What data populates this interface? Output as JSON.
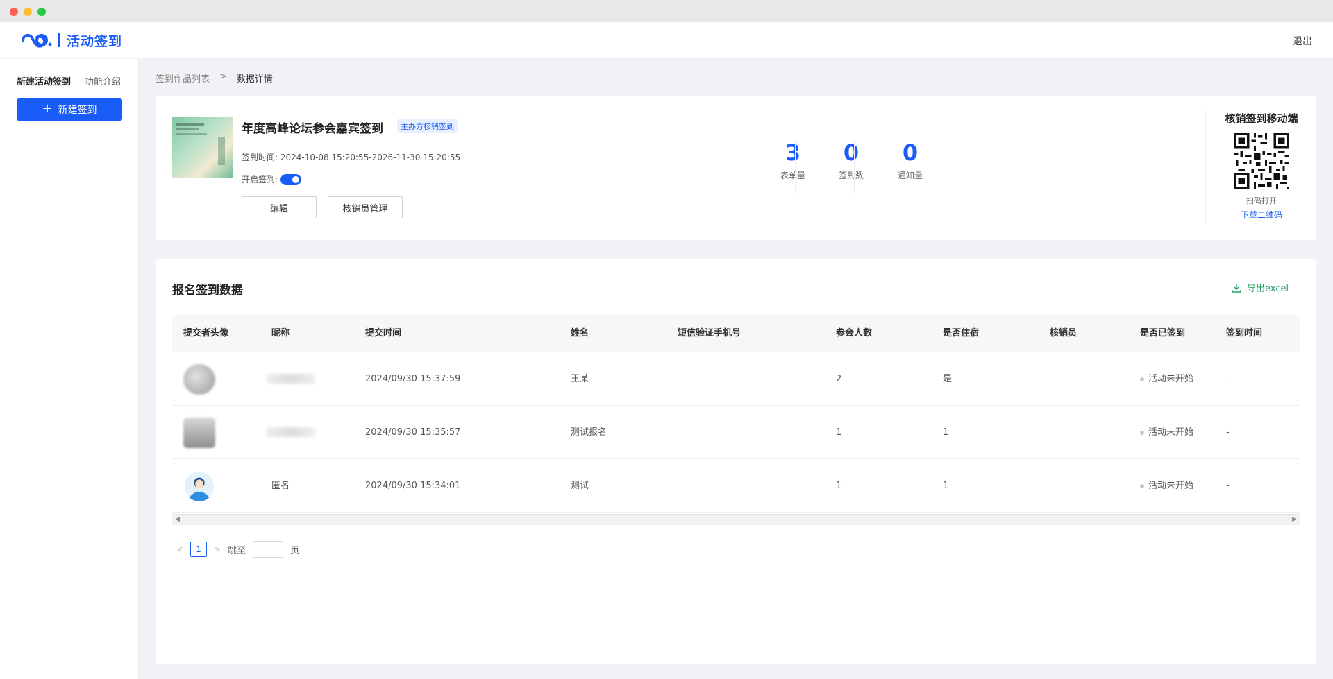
{
  "app": {
    "logo_text": "活动签到",
    "logout": "退出"
  },
  "sidebar": {
    "tabs": [
      "新建活动签到",
      "功能介绍"
    ],
    "new_button": "新建签到"
  },
  "breadcrumb": {
    "items": [
      "签到作品列表",
      "数据详情"
    ],
    "separator": ">"
  },
  "event": {
    "title": "年度高峰论坛参会嘉宾签到",
    "tag": "主办方核销签到",
    "time_label": "签到时间:",
    "time_range": "2024-10-08 15:20:55-2026-11-30 15:20:55",
    "toggle_label": "开启签到:",
    "toggle_on": true,
    "edit_button": "编辑",
    "staff_button": "核销员管理",
    "poster_title": "INVITATION LETTER"
  },
  "stats": [
    {
      "value": "3",
      "label": "表单量"
    },
    {
      "value": "0",
      "label": "签到数"
    },
    {
      "value": "0",
      "label": "通知量"
    }
  ],
  "mobile": {
    "title": "核销签到移动端",
    "scan_text": "扫码打开",
    "download": "下载二维码"
  },
  "data_section": {
    "title": "报名签到数据",
    "export": "导出excel",
    "columns": [
      "提交者头像",
      "昵称",
      "提交时间",
      "姓名",
      "短信验证手机号",
      "参会人数",
      "是否住宿",
      "核销员",
      "是否已签到",
      "签到时间"
    ],
    "rows": [
      {
        "nickname": "",
        "submit_time": "2024/09/30 15:37:59",
        "name": "王某",
        "phone": "",
        "count": "2",
        "lodging": "是",
        "staff": "",
        "status": "活动未开始",
        "checkin_time": "-"
      },
      {
        "nickname": "",
        "submit_time": "2024/09/30 15:35:57",
        "name": "测试报名",
        "phone": "",
        "count": "1",
        "lodging": "1",
        "staff": "",
        "status": "活动未开始",
        "checkin_time": "-"
      },
      {
        "nickname": "匿名",
        "submit_time": "2024/09/30 15:34:01",
        "name": "测试",
        "phone": "",
        "count": "1",
        "lodging": "1",
        "staff": "",
        "status": "活动未开始",
        "checkin_time": "-"
      }
    ]
  },
  "pagination": {
    "current": "1",
    "jump_label": "跳至",
    "page_suffix": "页"
  },
  "colors": {
    "primary": "#1a5cf7",
    "export_green": "#2aa06a"
  }
}
